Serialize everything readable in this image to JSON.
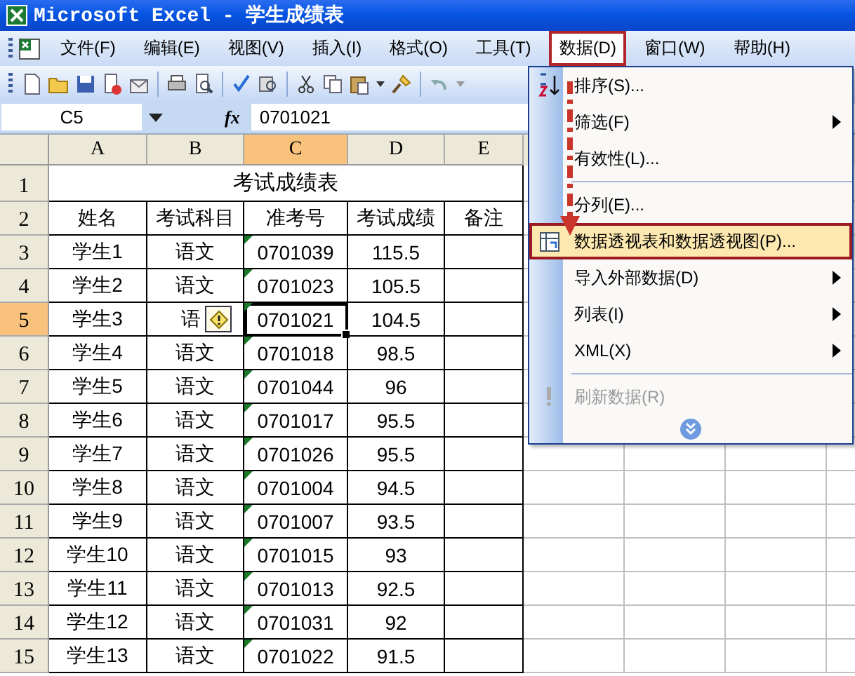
{
  "window": {
    "title": "Microsoft Excel - 学生成绩表"
  },
  "menu_bar": [
    {
      "label": "文件(F)",
      "selected": false,
      "annotated": false
    },
    {
      "label": "编辑(E)",
      "selected": false,
      "annotated": false
    },
    {
      "label": "视图(V)",
      "selected": false,
      "annotated": false
    },
    {
      "label": "插入(I)",
      "selected": false,
      "annotated": false
    },
    {
      "label": "格式(O)",
      "selected": false,
      "annotated": false
    },
    {
      "label": "工具(T)",
      "selected": false,
      "annotated": false
    },
    {
      "label": "数据(D)",
      "selected": true,
      "annotated": true
    },
    {
      "label": "窗口(W)",
      "selected": false,
      "annotated": false
    },
    {
      "label": "帮助(H)",
      "selected": false,
      "annotated": false
    }
  ],
  "formula_bar": {
    "name_box": "C5",
    "function_label": "fx",
    "formula": "0701021"
  },
  "sheet": {
    "columns": [
      {
        "label": "A",
        "selected": false
      },
      {
        "label": "B",
        "selected": false
      },
      {
        "label": "C",
        "selected": true
      },
      {
        "label": "D",
        "selected": false
      },
      {
        "label": "E",
        "selected": false
      }
    ],
    "rows": [
      {
        "header": "1",
        "selected": false,
        "kind": "title",
        "title": "考试成绩表"
      },
      {
        "header": "2",
        "selected": false,
        "kind": "data",
        "cells": [
          {
            "text": "姓名"
          },
          {
            "text": "考试科目"
          },
          {
            "text": "准考号"
          },
          {
            "text": "考试成绩"
          },
          {
            "text": "备注"
          }
        ]
      },
      {
        "header": "3",
        "selected": false,
        "kind": "data",
        "cells": [
          {
            "text": "学生1"
          },
          {
            "text": "语文"
          },
          {
            "text": "0701039",
            "flagged": true
          },
          {
            "text": "115.5"
          }
        ]
      },
      {
        "header": "4",
        "selected": false,
        "kind": "data",
        "cells": [
          {
            "text": "学生2"
          },
          {
            "text": "语文"
          },
          {
            "text": "0701023",
            "flagged": true
          },
          {
            "text": "105.5"
          }
        ]
      },
      {
        "header": "5",
        "selected": true,
        "kind": "data",
        "cells": [
          {
            "text": "学生3"
          },
          {
            "text": "语",
            "smart_tag": true
          },
          {
            "text": "0701021",
            "flagged": true,
            "active": true
          },
          {
            "text": "104.5"
          }
        ]
      },
      {
        "header": "6",
        "selected": false,
        "kind": "data",
        "cells": [
          {
            "text": "学生4"
          },
          {
            "text": "语文"
          },
          {
            "text": "0701018",
            "flagged": true
          },
          {
            "text": "98.5"
          }
        ]
      },
      {
        "header": "7",
        "selected": false,
        "kind": "data",
        "cells": [
          {
            "text": "学生5"
          },
          {
            "text": "语文"
          },
          {
            "text": "0701044",
            "flagged": true
          },
          {
            "text": "96"
          }
        ]
      },
      {
        "header": "8",
        "selected": false,
        "kind": "data",
        "cells": [
          {
            "text": "学生6"
          },
          {
            "text": "语文"
          },
          {
            "text": "0701017",
            "flagged": true
          },
          {
            "text": "95.5"
          }
        ]
      },
      {
        "header": "9",
        "selected": false,
        "kind": "data",
        "cells": [
          {
            "text": "学生7"
          },
          {
            "text": "语文"
          },
          {
            "text": "0701026",
            "flagged": true
          },
          {
            "text": "95.5"
          }
        ]
      },
      {
        "header": "10",
        "selected": false,
        "kind": "data",
        "cells": [
          {
            "text": "学生8"
          },
          {
            "text": "语文"
          },
          {
            "text": "0701004",
            "flagged": true
          },
          {
            "text": "94.5"
          }
        ]
      },
      {
        "header": "11",
        "selected": false,
        "kind": "data",
        "cells": [
          {
            "text": "学生9"
          },
          {
            "text": "语文"
          },
          {
            "text": "0701007",
            "flagged": true
          },
          {
            "text": "93.5"
          }
        ]
      },
      {
        "header": "12",
        "selected": false,
        "kind": "data",
        "cells": [
          {
            "text": "学生10"
          },
          {
            "text": "语文"
          },
          {
            "text": "0701015",
            "flagged": true
          },
          {
            "text": "93"
          }
        ]
      },
      {
        "header": "13",
        "selected": false,
        "kind": "data",
        "cells": [
          {
            "text": "学生11"
          },
          {
            "text": "语文"
          },
          {
            "text": "0701013",
            "flagged": true
          },
          {
            "text": "92.5"
          }
        ]
      },
      {
        "header": "14",
        "selected": false,
        "kind": "data",
        "cells": [
          {
            "text": "学生12"
          },
          {
            "text": "语文"
          },
          {
            "text": "0701031",
            "flagged": true
          },
          {
            "text": "92"
          }
        ]
      },
      {
        "header": "15",
        "selected": false,
        "kind": "data",
        "cells": [
          {
            "text": "学生13"
          },
          {
            "text": "语文"
          },
          {
            "text": "0701022",
            "flagged": true
          },
          {
            "text": "91.5"
          }
        ]
      }
    ]
  },
  "data_menu": {
    "annotation_arrow": true,
    "items": [
      {
        "label": "排序(S)...",
        "kind": "sort",
        "submenu": false,
        "disabled": false,
        "selected": false,
        "annotated": false,
        "separator_before": false
      },
      {
        "label": "筛选(F)",
        "submenu": true,
        "disabled": false,
        "selected": false,
        "annotated": false,
        "separator_before": false
      },
      {
        "label": "有效性(L)...",
        "submenu": false,
        "disabled": false,
        "selected": false,
        "annotated": false,
        "separator_before": false
      },
      {
        "label": "分列(E)...",
        "submenu": false,
        "disabled": false,
        "selected": false,
        "annotated": false,
        "separator_before": true
      },
      {
        "label": "数据透视表和数据透视图(P)...",
        "kind": "pivot",
        "submenu": false,
        "disabled": false,
        "selected": true,
        "annotated": true,
        "separator_before": false
      },
      {
        "label": "导入外部数据(D)",
        "submenu": true,
        "disabled": false,
        "selected": false,
        "annotated": false,
        "separator_before": false
      },
      {
        "label": "列表(I)",
        "submenu": true,
        "disabled": false,
        "selected": false,
        "annotated": false,
        "separator_before": false
      },
      {
        "label": "XML(X)",
        "submenu": true,
        "disabled": false,
        "selected": false,
        "annotated": false,
        "separator_before": false
      },
      {
        "label": "刷新数据(R)",
        "kind": "refresh",
        "submenu": false,
        "disabled": true,
        "selected": false,
        "annotated": false,
        "separator_before": true
      }
    ]
  }
}
